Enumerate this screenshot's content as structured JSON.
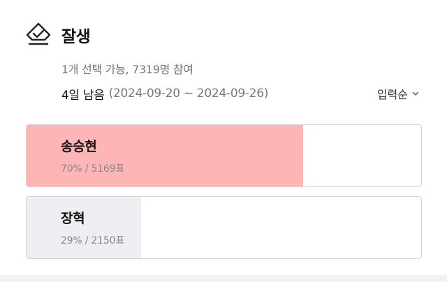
{
  "poll": {
    "title": "잘생",
    "meta": "1개 선택 가능, 7319명 참여",
    "remaining": "4일 남음",
    "date_range": "(2024-09-20 ~ 2024-09-26)",
    "sort_label": "입력순",
    "options": [
      {
        "name": "송승현",
        "stat": "70% / 5169표",
        "percent": 70,
        "fill_color": "#fdb5b6"
      },
      {
        "name": "장혁",
        "stat": "29% / 2150표",
        "percent": 29,
        "fill_color": "#eceef1"
      }
    ]
  },
  "icons": {
    "poll": "check-diamond-icon",
    "sort": "chevron-down-icon"
  }
}
